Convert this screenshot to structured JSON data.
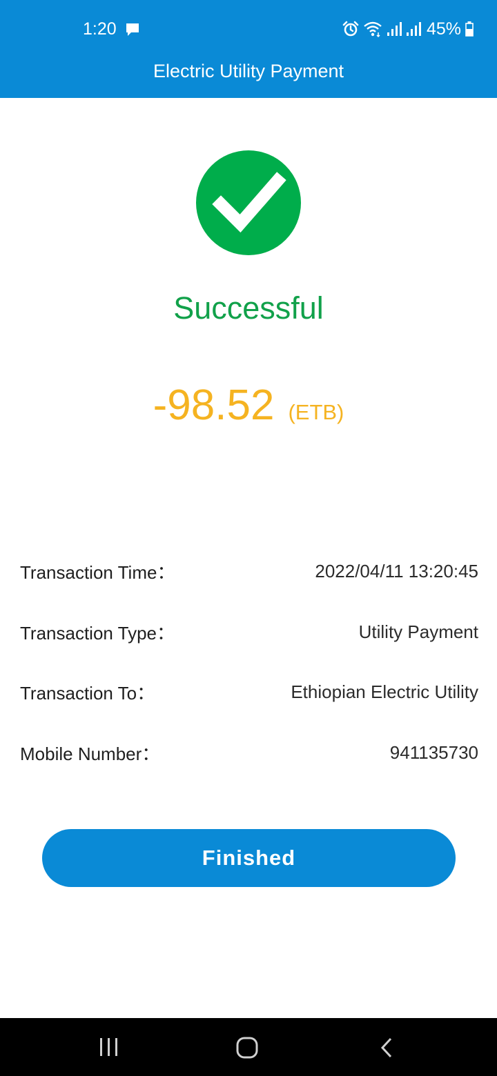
{
  "status_bar": {
    "time": "1:20",
    "battery": "45%",
    "icons": [
      "message-icon",
      "alarm-icon",
      "wifi-icon",
      "signal-icon",
      "signal-icon",
      "battery-icon"
    ]
  },
  "header": {
    "title": "Electric Utility Payment"
  },
  "result": {
    "icon": "check-circle-icon",
    "status": "Successful",
    "amount": "-98.52",
    "currency": "(ETB)"
  },
  "details": [
    {
      "label": "Transaction Time：",
      "value": "2022/04/11 13:20:45"
    },
    {
      "label": "Transaction Type：",
      "value": "Utility Payment"
    },
    {
      "label": "Transaction To：",
      "value": "Ethiopian Electric Utility"
    },
    {
      "label": "Mobile Number：",
      "value": "941135730"
    }
  ],
  "actions": {
    "finish_label": "Finished"
  },
  "nav": {
    "icons": [
      "recent-apps-icon",
      "home-icon",
      "back-icon"
    ]
  },
  "colors": {
    "primary": "#0a8ad6",
    "success": "#00ad4b",
    "amount": "#f5b321"
  }
}
